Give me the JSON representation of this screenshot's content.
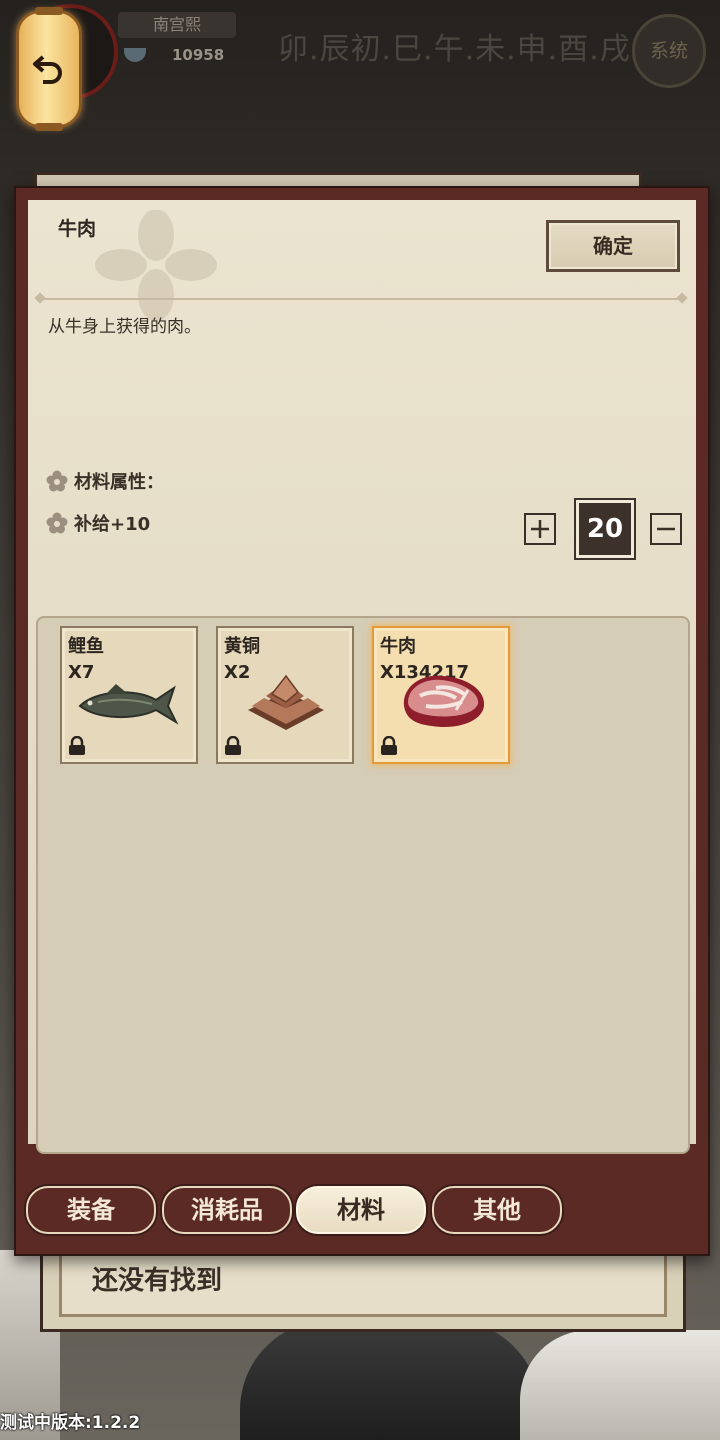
{
  "player": {
    "name": "南宫熙",
    "currency": "10958"
  },
  "header": {
    "hours": "卯.辰初.巳.午.未.申.酉.戌",
    "system_label": "系统"
  },
  "item": {
    "name": "牛肉",
    "description": "从牛身上获得的肉。",
    "attributes_label": "材料属性：",
    "attribute_1": "补给+10"
  },
  "actions": {
    "confirm_label": "确定"
  },
  "quantity": {
    "value": "20"
  },
  "inventory": {
    "slots": [
      {
        "name": "鲤鱼",
        "count": "X7",
        "icon": "fish-icon"
      },
      {
        "name": "黄铜",
        "count": "X2",
        "icon": "brass-ingot-icon"
      },
      {
        "name": "牛肉",
        "count": "X134217",
        "icon": "beef-icon",
        "selected": true
      }
    ]
  },
  "tabs": [
    {
      "label": "装备"
    },
    {
      "label": "消耗品"
    },
    {
      "label": "材料",
      "active": true
    },
    {
      "label": "其他"
    }
  ],
  "background": {
    "hint_text": "还没有找到"
  },
  "version": "测试中版本:1.2.2",
  "colors": {
    "panel_frame": "#5b2a24",
    "paper": "#e6dec8",
    "selected_glow": "#e29a3a"
  }
}
